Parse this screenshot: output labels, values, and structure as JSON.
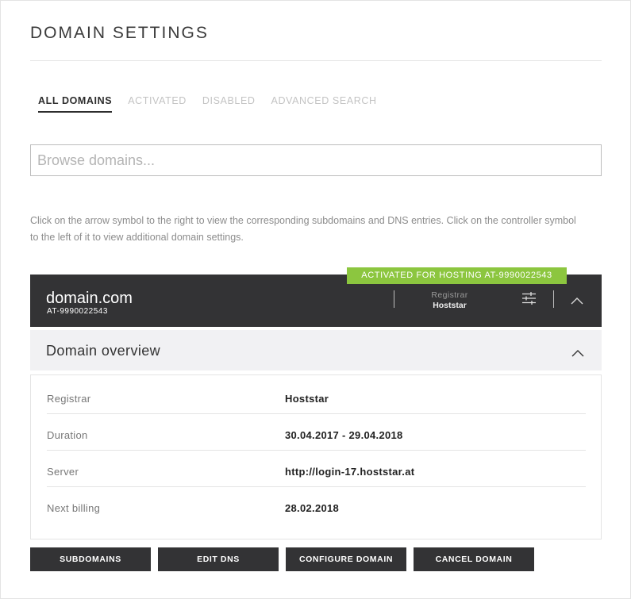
{
  "page": {
    "title": "DOMAIN SETTINGS"
  },
  "tabs": [
    {
      "label": "ALL DOMAINS",
      "active": true
    },
    {
      "label": "ACTIVATED",
      "active": false
    },
    {
      "label": "DISABLED",
      "active": false
    },
    {
      "label": "ADVANCED SEARCH",
      "active": false
    }
  ],
  "search": {
    "placeholder": "Browse domains...",
    "value": ""
  },
  "hint": "Click on the arrow symbol to the right to view the corresponding subdomains and DNS entries. Click on the controller symbol to the left of it to view additional domain settings.",
  "domain": {
    "status_badge": "ACTIVATED FOR HOSTING AT-9990022543",
    "name": "domain.com",
    "id": "AT-9990022543",
    "registrar_label": "Registrar",
    "registrar_value": "Hoststar",
    "settings_icon": "sliders-icon",
    "toggle_icon": "chevron-up-icon"
  },
  "overview": {
    "title": "Domain overview",
    "toggle_icon": "chevron-up-icon",
    "rows": [
      {
        "label": "Registrar",
        "value": "Hoststar"
      },
      {
        "label": "Duration",
        "value": "30.04.2017 - 29.04.2018"
      },
      {
        "label": "Server",
        "value": "http://login-17.hoststar.at"
      },
      {
        "label": "Next billing",
        "value": "28.02.2018"
      }
    ]
  },
  "actions": {
    "subdomains": "SUBDOMAINS",
    "edit_dns": "EDIT DNS",
    "configure": "CONFIGURE DOMAIN",
    "cancel": "CANCEL DOMAIN"
  },
  "colors": {
    "accent_green": "#8cc63f",
    "dark_bar": "#333335",
    "overview_bg": "#f1f1f3"
  }
}
